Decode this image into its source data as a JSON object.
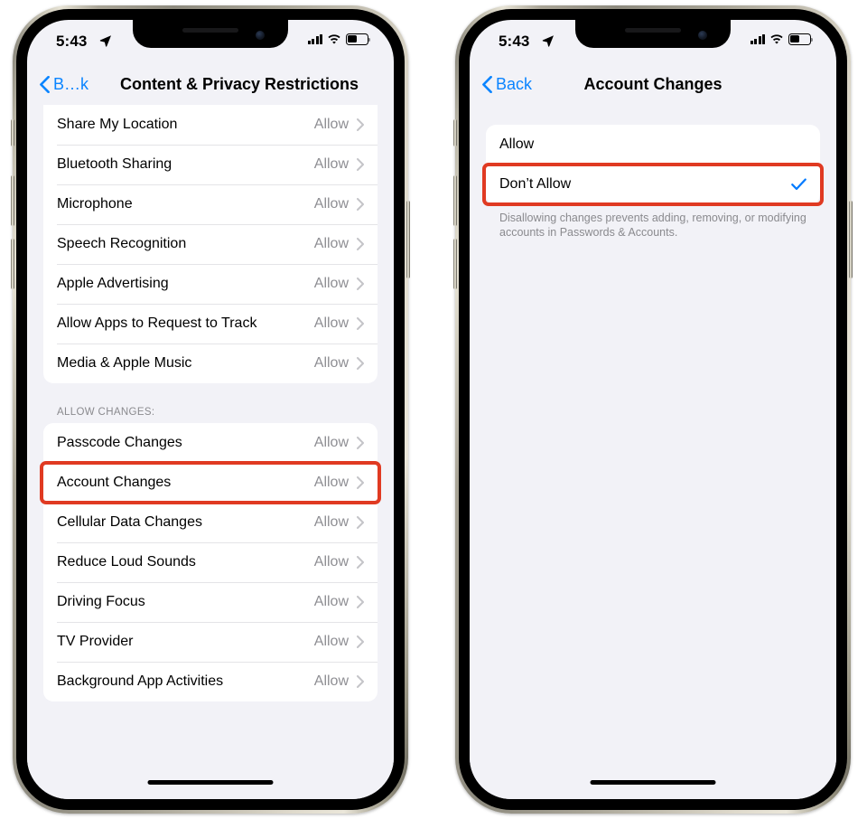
{
  "phones": [
    {
      "id": "left",
      "status_bar": {
        "time": "5:43",
        "location_icon": "location-arrow-icon",
        "cellular_icon": "cellular-bars-icon",
        "wifi_icon": "wifi-icon",
        "battery_icon": "battery-icon",
        "battery_level_percent": 40
      },
      "nav": {
        "back_label": "B…k",
        "back_icon": "chevron-left-icon",
        "title": "Content & Privacy Restrictions"
      },
      "sections": [
        {
          "header": "",
          "cut_top": true,
          "rows": [
            {
              "label": "Share My Location",
              "value": "Allow",
              "accessory": "chevron-right-icon"
            },
            {
              "label": "Bluetooth Sharing",
              "value": "Allow",
              "accessory": "chevron-right-icon"
            },
            {
              "label": "Microphone",
              "value": "Allow",
              "accessory": "chevron-right-icon"
            },
            {
              "label": "Speech Recognition",
              "value": "Allow",
              "accessory": "chevron-right-icon"
            },
            {
              "label": "Apple Advertising",
              "value": "Allow",
              "accessory": "chevron-right-icon"
            },
            {
              "label": "Allow Apps to Request to Track",
              "value": "Allow",
              "accessory": "chevron-right-icon"
            },
            {
              "label": "Media & Apple Music",
              "value": "Allow",
              "accessory": "chevron-right-icon"
            }
          ]
        },
        {
          "header": "ALLOW CHANGES:",
          "cut_top": false,
          "rows": [
            {
              "label": "Passcode Changes",
              "value": "Allow",
              "accessory": "chevron-right-icon"
            },
            {
              "label": "Account Changes",
              "value": "Allow",
              "accessory": "chevron-right-icon",
              "highlighted": true
            },
            {
              "label": "Cellular Data Changes",
              "value": "Allow",
              "accessory": "chevron-right-icon"
            },
            {
              "label": "Reduce Loud Sounds",
              "value": "Allow",
              "accessory": "chevron-right-icon"
            },
            {
              "label": "Driving Focus",
              "value": "Allow",
              "accessory": "chevron-right-icon"
            },
            {
              "label": "TV Provider",
              "value": "Allow",
              "accessory": "chevron-right-icon"
            },
            {
              "label": "Background App Activities",
              "value": "Allow",
              "accessory": "chevron-right-icon"
            }
          ]
        }
      ]
    },
    {
      "id": "right",
      "status_bar": {
        "time": "5:43",
        "location_icon": "location-arrow-icon",
        "cellular_icon": "cellular-bars-icon",
        "wifi_icon": "wifi-icon",
        "battery_icon": "battery-icon",
        "battery_level_percent": 40
      },
      "nav": {
        "back_label": "Back",
        "back_icon": "chevron-left-icon",
        "title": "Account Changes"
      },
      "options": [
        {
          "label": "Allow",
          "selected": false,
          "highlighted": false
        },
        {
          "label": "Don’t Allow",
          "selected": true,
          "highlighted": true,
          "accessory": "checkmark-icon"
        }
      ],
      "footnote": "Disallowing changes prevents adding, removing, or modifying accounts in Passwords & Accounts."
    }
  ],
  "colors": {
    "highlight_red": "#e03a22",
    "accent_blue": "#0a84ff",
    "checkmark_blue": "#007aff",
    "secondary_text": "#8e8e93",
    "screen_background": "#f2f2f7",
    "card_background": "#ffffff"
  }
}
